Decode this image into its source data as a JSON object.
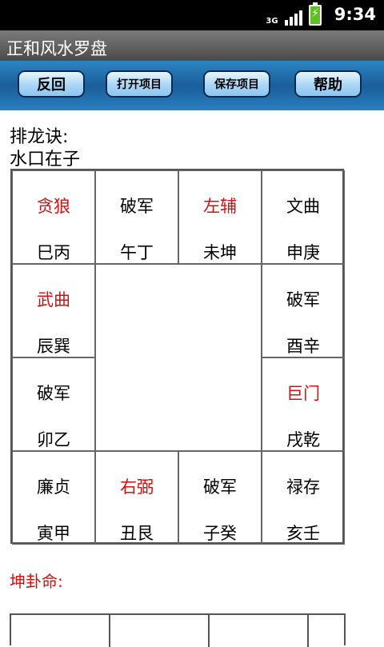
{
  "status": {
    "network": "3G",
    "time": "9:34"
  },
  "app": {
    "title": "正和风水罗盘"
  },
  "toolbar": {
    "back": "反回",
    "open": "打开项目",
    "save": "保存项目",
    "help": "帮助"
  },
  "content": {
    "rule_label": "排龙诀:",
    "water_outlet": "水口在子",
    "destiny_label": "坤卦命:"
  },
  "cells": [
    {
      "star": "贪狼",
      "dirs": "巳丙",
      "red": true
    },
    {
      "star": "破军",
      "dirs": "午丁",
      "red": false
    },
    {
      "star": "左辅",
      "dirs": "未坤",
      "red": true
    },
    {
      "star": "文曲",
      "dirs": "申庚",
      "red": false
    },
    {
      "star": "武曲",
      "dirs": "辰巽",
      "red": true
    },
    {
      "star": "破军",
      "dirs": "酉辛",
      "red": false
    },
    {
      "star": "破军",
      "dirs": "卯乙",
      "red": false
    },
    {
      "star": "巨门",
      "dirs": "戌乾",
      "red": true
    },
    {
      "star": "廉贞",
      "dirs": "寅甲",
      "red": false
    },
    {
      "star": "右弼",
      "dirs": "丑艮",
      "red": true
    },
    {
      "star": "破军",
      "dirs": "子癸",
      "red": false
    },
    {
      "star": "禄存",
      "dirs": "亥壬",
      "red": false
    }
  ]
}
